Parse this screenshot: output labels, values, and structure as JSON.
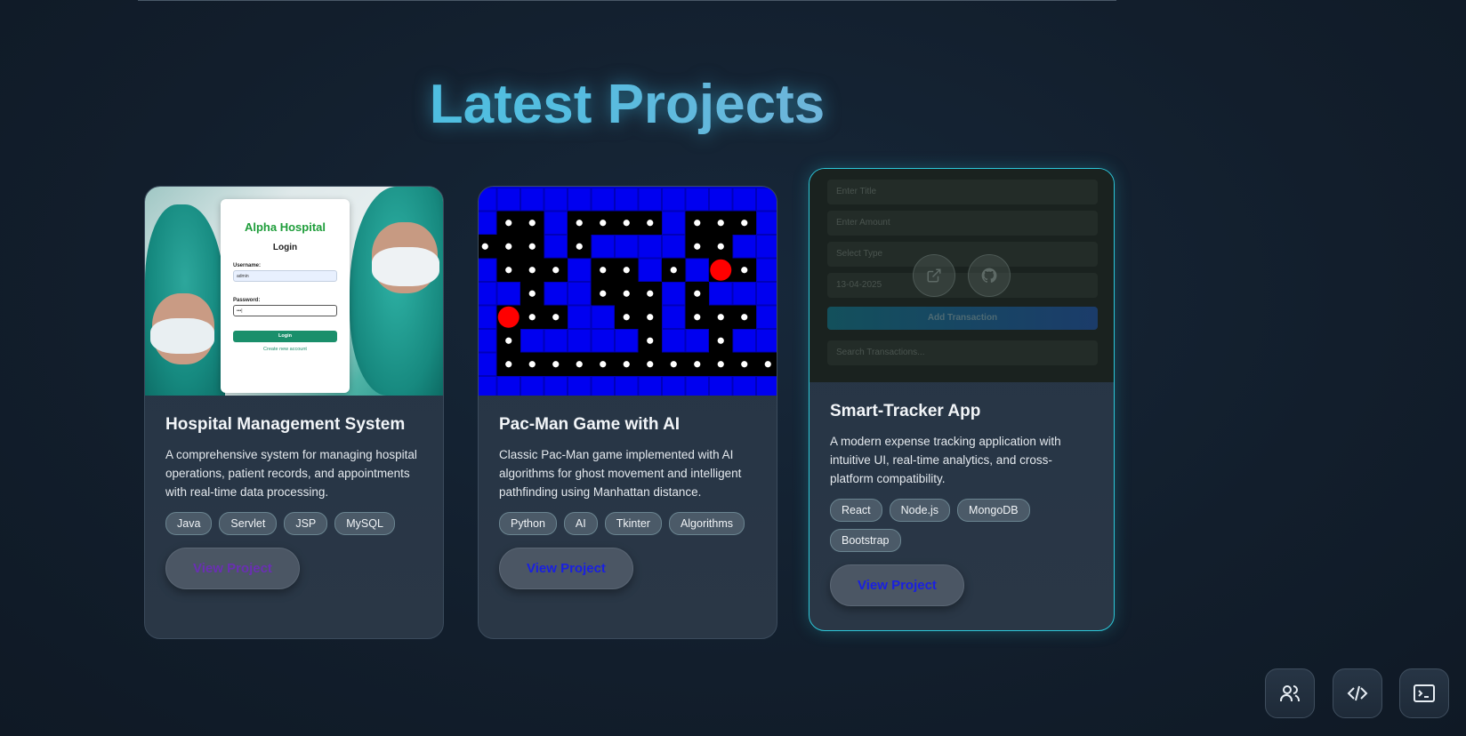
{
  "page": {
    "title": "Latest Projects"
  },
  "colors": {
    "accent": "#2cc7d8",
    "button_text": "#1a20e0",
    "tag_bg": "#4b5a68"
  },
  "projects": [
    {
      "title": "Hospital Management System",
      "description": "A comprehensive system for managing hospital operations, patient records, and appointments with real-time data processing.",
      "tags": [
        "Java",
        "Servlet",
        "JSP",
        "MySQL"
      ],
      "button": "View Project",
      "thumbnail": {
        "app_name": "Alpha Hospital",
        "heading": "Login",
        "username_label": "Username:",
        "username_value": "admin",
        "password_label": "Password:",
        "password_value": "•••|",
        "login_button": "Login",
        "create_link": "Create new account"
      }
    },
    {
      "title": "Pac-Man Game with AI",
      "description": "Classic Pac-Man game implemented with AI algorithms for ghost movement and intelligent pathfinding using Manhattan distance.",
      "tags": [
        "Python",
        "AI",
        "Tkinter",
        "Algorithms"
      ],
      "button": "View Project"
    },
    {
      "title": "Smart-Tracker App",
      "description": "A modern expense tracking application with intuitive UI, real-time analytics, and cross-platform compatibility.",
      "tags": [
        "React",
        "Node.js",
        "MongoDB",
        "Bootstrap"
      ],
      "button": "View Project",
      "thumbnail": {
        "title_placeholder": "Enter Title",
        "amount_placeholder": "Enter Amount",
        "type_select": "Select Type",
        "date_value": "13-04-2025",
        "add_button": "Add Transaction",
        "search_placeholder": "Search Transactions..."
      }
    }
  ],
  "fabs": [
    {
      "icon": "users-icon"
    },
    {
      "icon": "code-icon"
    },
    {
      "icon": "terminal-icon"
    }
  ]
}
